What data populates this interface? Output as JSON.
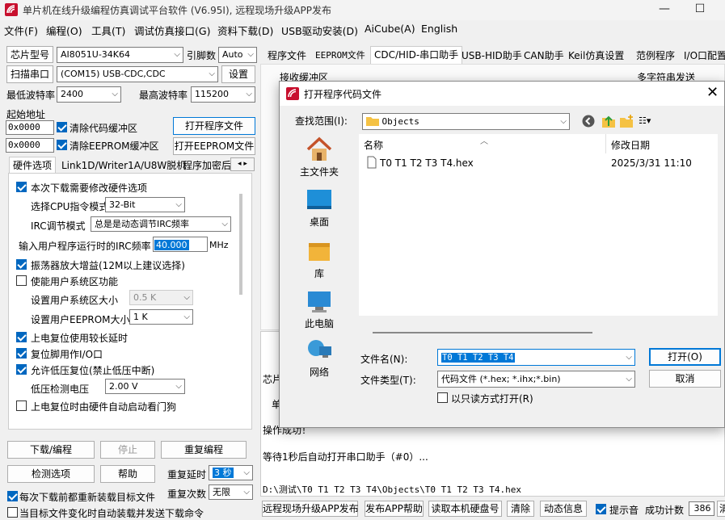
{
  "window": {
    "title": "单片机在线升级编程仿真调试平台软件 (V6.95I), 远程现场升级APP发布",
    "minimize": "—",
    "maximize": "☐"
  },
  "menu": [
    "文件(F)",
    "编程(O)",
    "工具(T)",
    "调试仿真接口(G)",
    "资料下载(D)",
    "USB驱动安装(D)",
    "AiCube(A)",
    "English"
  ],
  "left": {
    "chip_label": "芯片型号",
    "chip_value": "AI8051U-34K64",
    "pin_label": "引脚数",
    "pin_value": "Auto",
    "scan_button": "扫描串口",
    "port_value": "(COM15) USB-CDC,CDC",
    "settings_button": "设置",
    "min_baud_label": "最低波特率",
    "min_baud_value": "2400",
    "max_baud_label": "最高波特率",
    "max_baud_value": "115200",
    "start_addr_label": "起始地址",
    "addr1": "0x0000",
    "clear_code": "清除代码缓冲区",
    "open_program": "打开程序文件",
    "addr2": "0x0000",
    "clear_eeprom": "清除EEPROM缓冲区",
    "open_eeprom": "打开EEPROM文件",
    "tabs": [
      "硬件选项",
      "Link1D/Writer1A/U8W脱机",
      "程序加密后"
    ],
    "hw": {
      "opt_modify": "本次下载需要修改硬件选项",
      "cpu_mode_label": "选择CPU指令模式",
      "cpu_mode_value": "32-Bit",
      "irc_mode_label": "IRC调节模式",
      "irc_mode_value": "总是是动态调节IRC频率",
      "freq_label": "输入用户程序运行时的IRC频率",
      "freq_value": "40.000",
      "freq_unit": "MHz",
      "osc_gain": "振荡器放大增益(12M以上建议选择)",
      "sys_area": "使能用户系统区功能",
      "sys_size_label": "设置用户系统区大小",
      "sys_size_value": "0.5 K",
      "eeprom_size_label": "设置用户EEPROM大小",
      "eeprom_size_value": "1   K",
      "reset_delay": "上电复位使用较长延时",
      "reset_pin": "复位脚用作I/O口",
      "lvr": "允许低压复位(禁止低压中断)",
      "lvd_label": "低压检测电压",
      "lvd_value": "2.00 V",
      "wdt": "上电复位时由硬件自动启动看门狗"
    },
    "download_button": "下载/编程",
    "stop_button": "停止",
    "reprogram_button": "重复编程",
    "detect_button": "检测选项",
    "help_button": "帮助",
    "repeat_delay_label": "重复延时",
    "repeat_delay_value": "3 秒",
    "repeat_count_label": "重复次数",
    "repeat_count_value": "无限",
    "reload_each": "每次下载前都重新装载目标文件",
    "reload_auto": "当目标文件变化时自动装载并发送下载命令"
  },
  "right": {
    "tabs": [
      "程序文件",
      "EEPROM文件",
      "CDC/HID-串口助手",
      "USB-HID助手",
      "CAN助手",
      "Keil仿真设置",
      "范例程序",
      "I/O口配置"
    ],
    "recv_label": "接收缓冲区",
    "multi_send": "多字符串发送",
    "chip_prefix": "芯片",
    "chip_prefix2": "单",
    "log1": "操作成功！",
    "log2": "等待1秒后自动打开串口助手（#0）...",
    "path": "D:\\测试\\T0 T1 T2  T3 T4\\Objects\\T0 T1 T2  T3 T4.hex"
  },
  "statusbar": {
    "publish": "远程现场升级APP发布",
    "publish_help": "发布APP帮助",
    "read_disk": "读取本机硬盘号",
    "clear": "清除",
    "dynamic": "动态信息",
    "beep": "提示音",
    "success_label": "成功计数",
    "success_count": "386",
    "clear2": "清零"
  },
  "dialog": {
    "title": "打开程序代码文件",
    "lookin_label": "查找范围(I):",
    "lookin_value": "Objects",
    "places": [
      "主文件夹",
      "桌面",
      "库",
      "此电脑",
      "网络"
    ],
    "col_name": "名称",
    "col_date": "修改日期",
    "files": [
      {
        "name": "T0 T1 T2  T3 T4.hex",
        "date": "2025/3/31 11:10"
      }
    ],
    "filename_label": "文件名(N):",
    "filename_value": "T0 T1 T2  T3 T4",
    "filetype_label": "文件类型(T):",
    "filetype_value": "代码文件 (*.hex; *.ihx;*.bin)",
    "readonly": "以只读方式打开(R)",
    "open_button": "打开(O)",
    "cancel_button": "取消"
  }
}
